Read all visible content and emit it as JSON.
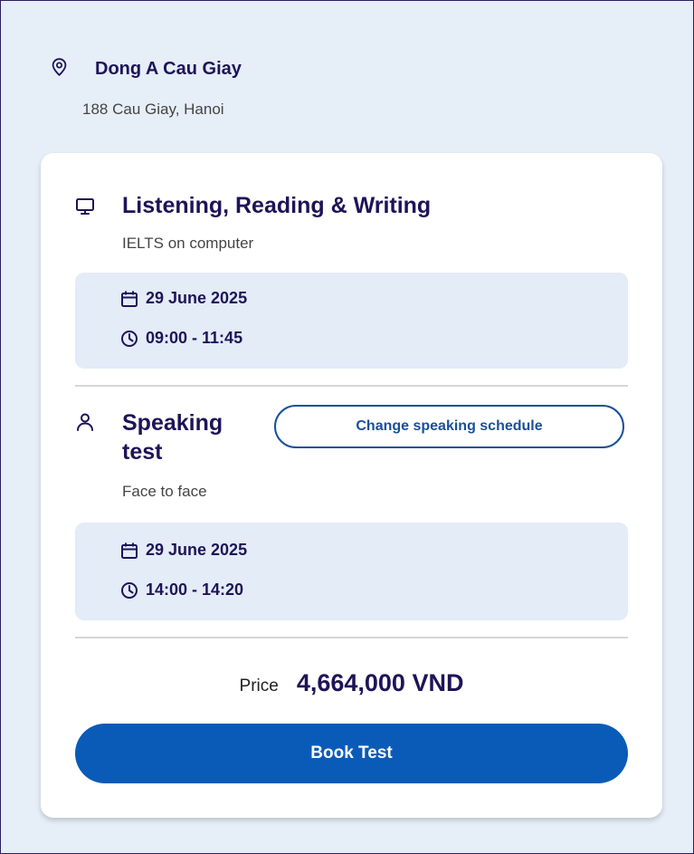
{
  "venue": {
    "name": "Dong A Cau Giay",
    "address": "188 Cau Giay, Hanoi"
  },
  "written_test": {
    "title": "Listening, Reading & Writing",
    "subtitle": "IELTS on computer",
    "date": "29 June 2025",
    "time": "09:00 - 11:45"
  },
  "speaking_test": {
    "title_line1": "Speaking",
    "title_line2": "test",
    "subtitle": "Face to face",
    "change_button": "Change speaking schedule",
    "date": "29 June 2025",
    "time": "14:00 - 14:20"
  },
  "price": {
    "label": "Price",
    "value": "4,664,000 VND"
  },
  "book_button": "Book Test",
  "icons": {
    "venue": "location-pin-icon",
    "written": "monitor-icon",
    "speaking": "person-icon",
    "date": "calendar-icon",
    "time": "clock-icon"
  },
  "colors": {
    "page_background": "#e6eef8",
    "primary": "#0a5bb8",
    "heading": "#1e1457",
    "slot_background": "#e3ecf7"
  }
}
